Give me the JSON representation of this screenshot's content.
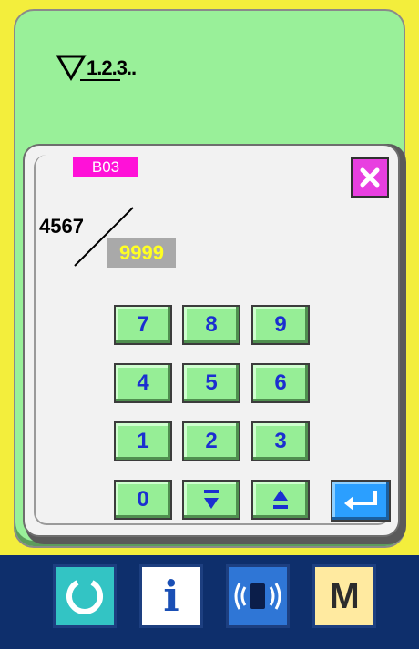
{
  "header": {
    "counter_label": "1.2.3..",
    "counter_icon": "down-counter-icon"
  },
  "popup": {
    "tag": "B03",
    "close_icon": "close-x-icon",
    "current_value": "4567",
    "max_value": "9999"
  },
  "keypad": {
    "keys": [
      "7",
      "8",
      "9",
      "4",
      "5",
      "6",
      "1",
      "2",
      "3",
      "0"
    ],
    "down_icon": "decrement-arrow-icon",
    "up_icon": "increment-arrow-icon",
    "enter_icon": "enter-return-icon"
  },
  "bottom_bar": {
    "reset_icon": "reset-circle-icon",
    "info_label": "i",
    "comm_icon": "communication-icon",
    "mode_label": "M"
  },
  "colors": {
    "main_bg": "#99f099",
    "frame": "#f3ee3c",
    "tag_bg": "#ff11d8",
    "close_bg": "#e83fe0",
    "key_bg": "#96ee96",
    "key_text": "#1b2fd0",
    "enter_bg": "#2b9fff",
    "bottom_bar": "#0e2f6c"
  }
}
